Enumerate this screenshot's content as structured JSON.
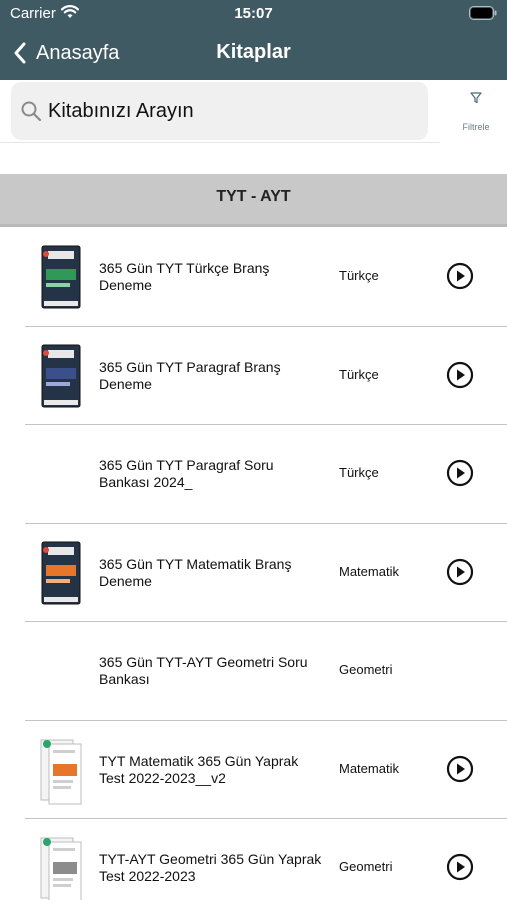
{
  "status_bar": {
    "carrier": "Carrier",
    "time": "15:07"
  },
  "nav": {
    "back_label": "Anasayfa",
    "title": "Kitaplar"
  },
  "search": {
    "placeholder": "Kitabınızı Arayın",
    "filter_label": "Filtrele"
  },
  "section": {
    "title": "TYT - AYT"
  },
  "books": [
    {
      "title": "365 Gün TYT Türkçe Branş Deneme",
      "subject": "Türkçe",
      "cover": "green",
      "has_play": true
    },
    {
      "title": "365 Gün TYT Paragraf Branş Deneme",
      "subject": "Türkçe",
      "cover": "navy",
      "has_play": true
    },
    {
      "title": "365 Gün TYT Paragraf Soru Bankası 2024_",
      "subject": "Türkçe",
      "cover": "none",
      "has_play": true
    },
    {
      "title": "365 Gün TYT Matematik Branş Deneme",
      "subject": "Matematik",
      "cover": "orange",
      "has_play": true
    },
    {
      "title": "365 Gün TYT-AYT Geometri Soru Bankası",
      "subject": "Geometri",
      "cover": "none",
      "has_play": false
    },
    {
      "title": "TYT Matematik 365 Gün Yaprak Test 2022-2023__v2",
      "subject": "Matematik",
      "cover": "leaf-orange",
      "has_play": true
    },
    {
      "title": "TYT-AYT Geometri 365 Gün Yaprak Test 2022-2023",
      "subject": "Geometri",
      "cover": "leaf-gray",
      "has_play": true
    }
  ],
  "colors": {
    "header_bg": "#3f5a63",
    "section_bg": "#c8c8c8",
    "search_bg": "#f0f0f0"
  }
}
